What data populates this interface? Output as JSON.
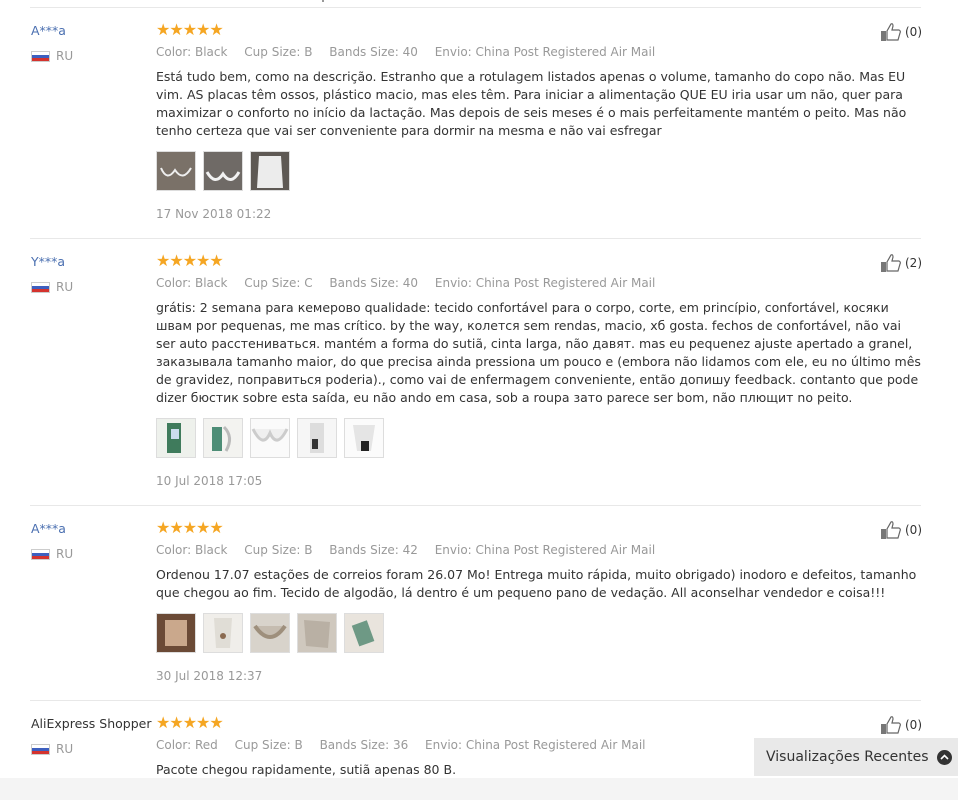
{
  "reviews": [
    {
      "user": "A***a",
      "country": "RU",
      "color": "Color: Black",
      "cup": "Cup Size: B",
      "bands": "Bands Size: 40",
      "shipping": "Envio: China Post Registered Air Mail",
      "text": "Está tudo bem, como na descrição. Estranho que a rotulagem listados apenas o volume, tamanho do copo não. Mas EU vim. AS placas têm ossos, plástico macio, mas eles têm. Para iniciar a alimentação QUE EU iria usar um não, quer para maximizar o conforto no início da lactação. Mas depois de seis meses é o mais perfeitamente mantém o peito. Mas não tenho certeza que vai ser conveniente para dormir na mesma e não vai esfregar",
      "date": "17 Nov 2018 01:22",
      "likes": "(0)"
    },
    {
      "user": "Y***a",
      "country": "RU",
      "color": "Color: Black",
      "cup": "Cup Size: C",
      "bands": "Bands Size: 40",
      "shipping": "Envio: China Post Registered Air Mail",
      "text": "grátis: 2 semana para кемерово qualidade: tecido confortável para o corpo, corte, em princípio, confortável, косяки швам por pequenas, me mas crítico. by the way, колется sem rendas, macio, хб gosta. fechos de confortável, não vai ser auto расстениваться. mantém a forma do sutiã, cinta larga, não давят. mas eu pequenez ajuste apertado a granel, заказывала tamanho maior, do que precisa ainda pressiona um pouco e (embora não lidamos com ele, eu no último mês de gravidez, поправиться poderia)., como vai de enfermagem conveniente, então допишу feedback. contanto que pode dizer бюстик sobre esta saída, eu não ando em casa, sob a roupa зато parece ser bom, não плющит no peito.",
      "date": "10 Jul 2018 17:05",
      "likes": "(2)"
    },
    {
      "user": "A***a",
      "country": "RU",
      "color": "Color: Black",
      "cup": "Cup Size: B",
      "bands": "Bands Size: 42",
      "shipping": "Envio: China Post Registered Air Mail",
      "text": "Ordenou 17.07 estações de correios foram 26.07 Mo! Entrega muito rápida, muito obrigado) inodoro e defeitos, tamanho que chegou ao fim. Tecido de algodão, lá dentro é um pequeno pano de vedação. All aconselhar vendedor e coisa!!!",
      "date": "30 Jul 2018 12:37",
      "likes": "(0)"
    },
    {
      "user": "AliExpress Shopper",
      "country": "RU",
      "color": "Color: Red",
      "cup": "Cup Size: B",
      "bands": "Bands Size: 36",
      "shipping": "Envio: China Post Registered Air Mail",
      "text": "Pacote chegou rapidamente, sutiã apenas 80 B.",
      "likes": "(0)"
    }
  ],
  "stars": "★★★★★",
  "recent": {
    "label": "Visualizações Recentes",
    "icon": "chevron-up-icon"
  },
  "colors": {
    "star": "#f5a623",
    "user_link": "#4a6fb0",
    "meta": "#999999"
  }
}
